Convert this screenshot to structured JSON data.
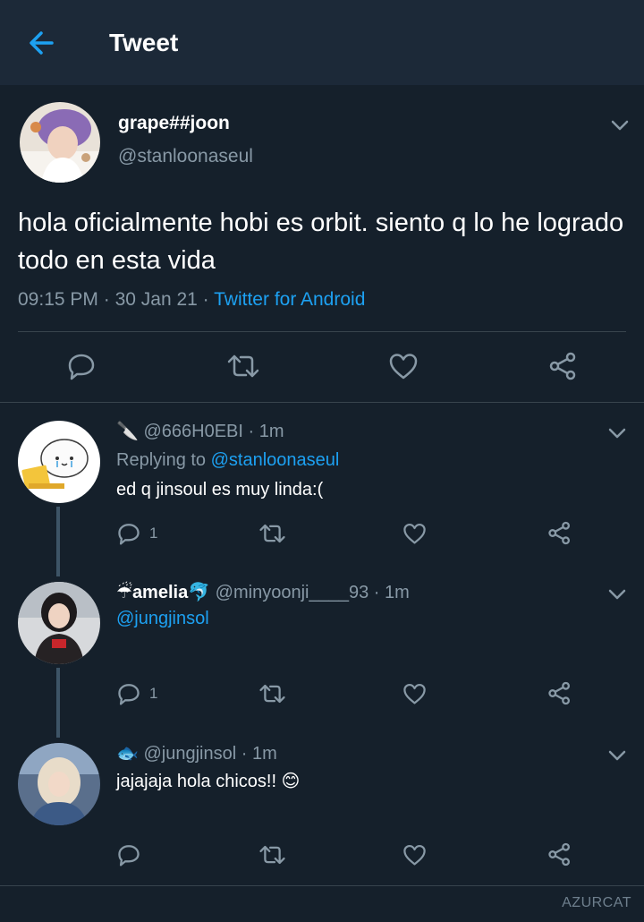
{
  "header": {
    "title": "Tweet"
  },
  "tweet": {
    "name": "grape##joon",
    "handle": "@stanloonaseul",
    "text": "hola oficialmente hobi es orbit. siento q lo he logrado todo en esta vida",
    "time": "09:15 PM",
    "date": "30 Jan 21",
    "source": "Twitter for Android",
    "sep": "·"
  },
  "replies": [
    {
      "emoji": "🔪",
      "handle": "@666H0EBI",
      "time": "1m",
      "replying_prefix": "Replying to",
      "replying_to": "@stanloonaseul",
      "text": "ed q jinsoul es muy linda:(",
      "reply_count": "1"
    },
    {
      "name_emoji_left": "☔",
      "name": "amelia",
      "name_emoji_right": "🐬",
      "handle": "@minyoonji____93",
      "time": "1m",
      "mention": "@jungjinsol",
      "reply_count": "1"
    },
    {
      "emoji": "🐟",
      "handle": "@jungjinsol",
      "time": "1m",
      "text": "jajajaja hola chicos!! 😊"
    }
  ],
  "watermark": "AZURCAT",
  "colors": {
    "background": "#15202b",
    "header": "#1c2938",
    "accent": "#1da1f2",
    "muted": "#8899a6"
  },
  "icons": [
    "back-arrow-icon",
    "chevron-down-icon",
    "reply-icon",
    "retweet-icon",
    "like-icon",
    "share-icon"
  ]
}
